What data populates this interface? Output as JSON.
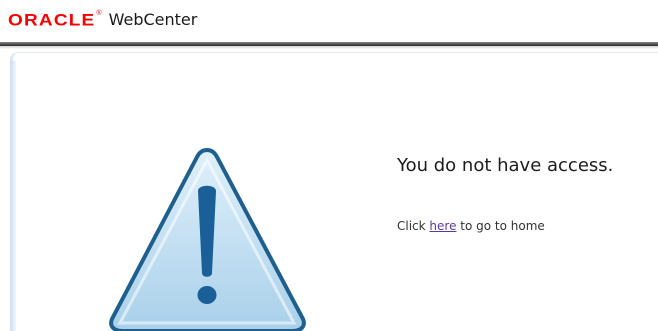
{
  "header": {
    "logo_text": "ORACLE",
    "trademark": "®",
    "product_name": "WebCenter"
  },
  "main": {
    "icon": "warning-triangle-icon",
    "title": "You do not have access.",
    "message_prefix": "Click",
    "link_text": "here",
    "message_suffix": "to go to home"
  },
  "colors": {
    "brand_red": "#f80000",
    "link": "#5a3c98",
    "warning_fill_top": "#dff0fa",
    "warning_fill_bottom": "#a9d0ea",
    "warning_stroke": "#1f5f8e",
    "warning_mark": "#1a5f97"
  }
}
